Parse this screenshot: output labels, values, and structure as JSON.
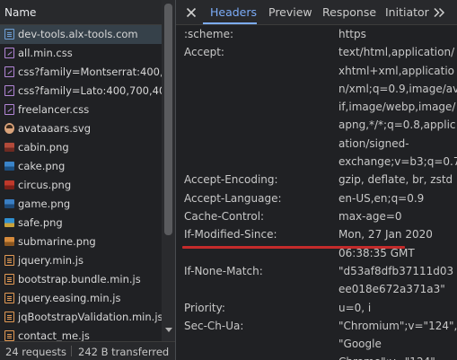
{
  "left_pane": {
    "column_header": "Name",
    "files": [
      {
        "name": "dev-tools.alx-tools.com",
        "icon": "document-icon",
        "selected": true
      },
      {
        "name": "all.min.css",
        "icon": "stylesheet-icon"
      },
      {
        "name": "css?family=Montserrat:400,...",
        "icon": "stylesheet-icon"
      },
      {
        "name": "css?family=Lato:400,700,40...",
        "icon": "stylesheet-icon"
      },
      {
        "name": "freelancer.css",
        "icon": "stylesheet-icon"
      },
      {
        "name": "avataaars.svg",
        "icon": "avatar-image-icon"
      },
      {
        "name": "cabin.png",
        "icon": "image-icon"
      },
      {
        "name": "cake.png",
        "icon": "image-icon"
      },
      {
        "name": "circus.png",
        "icon": "image-icon"
      },
      {
        "name": "game.png",
        "icon": "image-icon"
      },
      {
        "name": "safe.png",
        "icon": "image-icon"
      },
      {
        "name": "submarine.png",
        "icon": "image-icon"
      },
      {
        "name": "jquery.min.js",
        "icon": "script-icon"
      },
      {
        "name": "bootstrap.bundle.min.js",
        "icon": "script-icon"
      },
      {
        "name": "jquery.easing.min.js",
        "icon": "script-icon"
      },
      {
        "name": "jqBootstrapValidation.min.js",
        "icon": "script-icon"
      },
      {
        "name": "contact_me.js",
        "icon": "script-icon"
      }
    ],
    "status": {
      "requests": "24 requests",
      "transferred": "242 B transferred"
    }
  },
  "right_pane": {
    "tabs": [
      "Headers",
      "Preview",
      "Response",
      "Initiator"
    ],
    "active_tab": "Headers",
    "headers": [
      {
        "name": ":scheme:",
        "lines": [
          "https"
        ]
      },
      {
        "name": "Accept:",
        "lines": [
          "text/html,application/",
          "xhtml+xml,applicatio",
          "n/xml;q=0.9,image/av",
          "if,image/webp,image/",
          "apng,*/*;q=0.8,applic",
          "ation/signed-",
          "exchange;v=b3;q=0.7"
        ]
      },
      {
        "name": "Accept-Encoding:",
        "lines": [
          "gzip, deflate, br, zstd"
        ]
      },
      {
        "name": "Accept-Language:",
        "lines": [
          "en-US,en;q=0.9"
        ]
      },
      {
        "name": "Cache-Control:",
        "lines": [
          "max-age=0"
        ],
        "highlighted": true
      },
      {
        "name": "If-Modified-Since:",
        "lines": [
          "Mon, 27 Jan 2020",
          "06:38:35 GMT"
        ]
      },
      {
        "name": "If-None-Match:",
        "lines": [
          "\"d53af8dfb37111d03",
          "ee018e672a371a3\""
        ]
      },
      {
        "name": "Priority:",
        "lines": [
          "u=0, i"
        ]
      },
      {
        "name": "Sec-Ch-Ua:",
        "lines": [
          "\"Chromium\";v=\"124\",",
          "\"Google",
          "Chrome\";v=\"124\""
        ]
      }
    ]
  },
  "colors": {
    "background": "#202124",
    "selected_row": "#36414a",
    "active_tab": "#7cacf8",
    "annotation": "#c42b2b"
  }
}
